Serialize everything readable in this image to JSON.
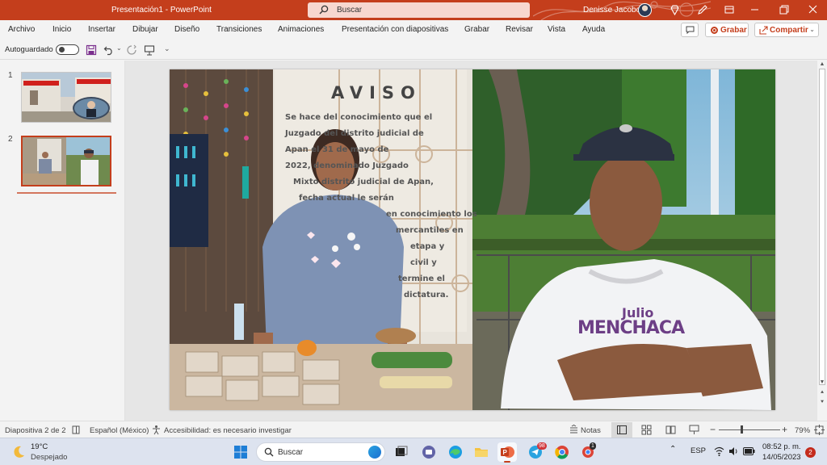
{
  "window": {
    "doc_title": "Presentación1  -  PowerPoint",
    "search_placeholder": "Buscar",
    "user_name": "Denisse Jacobo"
  },
  "menu": {
    "items": [
      "Archivo",
      "Inicio",
      "Insertar",
      "Dibujar",
      "Diseño",
      "Transiciones",
      "Animaciones",
      "Presentación con diapositivas",
      "Grabar",
      "Revisar",
      "Vista",
      "Ayuda"
    ],
    "record_label": "Grabar",
    "share_label": "Compartir"
  },
  "quick_access": {
    "autosave_label": "Autoguardado",
    "autosave_on": false
  },
  "thumbnails": {
    "slides": [
      {
        "number": "1",
        "selected": false
      },
      {
        "number": "2",
        "selected": true
      }
    ]
  },
  "slide": {
    "sign": {
      "title": "AVISO",
      "lines": [
        "Se hace del conocimiento que el",
        "Juzgado del distrito judicial de",
        "Apan el 31 de mayo de",
        "2022, denominado Juzgado",
        "Mixto distrito judicial de Apan,",
        "fecha actual le serán",
        "en conocimiento los",
        "mercantiles en",
        "etapa y",
        "civil y",
        "termine el",
        "dictatura."
      ]
    },
    "shirt": {
      "line1": "Julio",
      "line2": "MENCHACA"
    }
  },
  "statusbar": {
    "slide_indicator": "Diapositiva 2 de 2",
    "language": "Español (México)",
    "accessibility": "Accesibilidad: es necesario investigar",
    "notes_label": "Notas",
    "zoom": "79%",
    "zoom_value": 79
  },
  "taskbar": {
    "weather_temp": "19°C",
    "weather_desc": "Despejado",
    "search_placeholder": "Buscar",
    "lang": "ESP",
    "time": "08:52 p. m.",
    "date": "14/05/2023",
    "notifications": "2",
    "telegram_badge": "98",
    "messenger_badge": "1"
  }
}
